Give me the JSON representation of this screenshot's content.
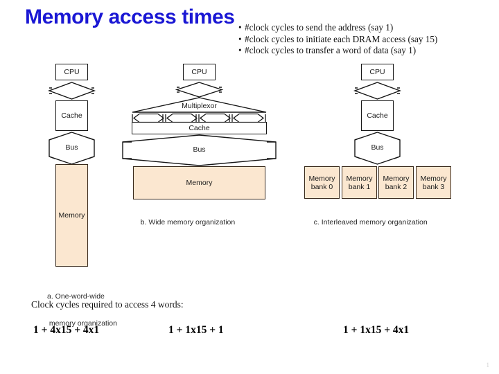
{
  "slide": {
    "title": "Memory access times",
    "title_color": "#1a17d4",
    "page_number": "1"
  },
  "bullets": {
    "marker": "•",
    "items": [
      "#clock cycles to send the address (say 1)",
      "#clock cycles to initiate each DRAM access (say 15)",
      "#clock cycles to transfer a word of data (say 1)"
    ]
  },
  "diagram_a": {
    "caption_line1": "a. One-word-wide",
    "caption_line2": " memory organization",
    "cpu": "CPU",
    "cache": "Cache",
    "bus": "Bus",
    "memory": "Memory"
  },
  "diagram_b": {
    "caption": "b. Wide memory organization",
    "cpu": "CPU",
    "multiplexor": "Multiplexor",
    "cache": "Cache",
    "bus": "Bus",
    "memory": "Memory"
  },
  "diagram_c": {
    "caption": "c. Interleaved memory organization",
    "cpu": "CPU",
    "cache": "Cache",
    "bus": "Bus",
    "banks": [
      {
        "line1": "Memory",
        "line2": "bank 0"
      },
      {
        "line1": "Memory",
        "line2": "bank 1"
      },
      {
        "line1": "Memory",
        "line2": "bank 2"
      },
      {
        "line1": "Memory",
        "line2": "bank 3"
      }
    ]
  },
  "bottom": {
    "heading": "Clock cycles required to access 4 words:",
    "formula_a": "1 + 4x15 + 4x1",
    "formula_b": "1 + 1x15 + 1",
    "formula_c": "1 + 1x15 + 4x1"
  },
  "colors": {
    "memory_fill": "#fbe7d0",
    "stroke": "#161616",
    "title_blue": "#1a17d4"
  }
}
